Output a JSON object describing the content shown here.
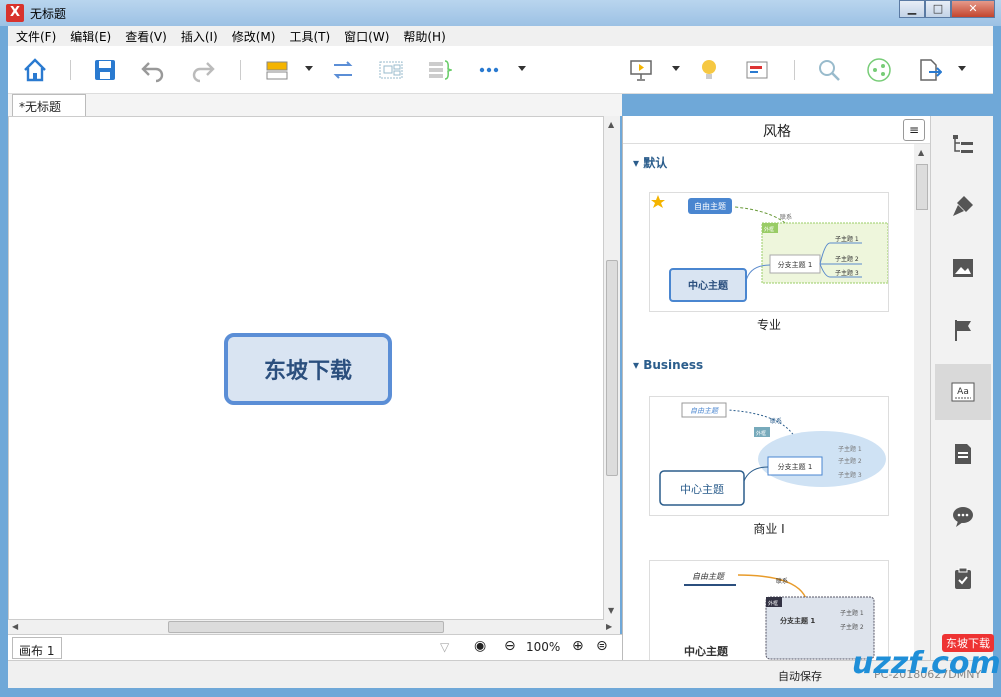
{
  "window": {
    "title": "无标题",
    "app_logo": "X",
    "min": "▁",
    "max": "□",
    "close": "✕"
  },
  "menu": [
    "文件(F)",
    "编辑(E)",
    "查看(V)",
    "插入(I)",
    "修改(M)",
    "工具(T)",
    "窗口(W)",
    "帮助(H)"
  ],
  "toolbar_icons": [
    "home-icon",
    "save-icon",
    "undo-icon",
    "redo-icon",
    "topic-icon",
    "relationship-icon",
    "boundary-icon",
    "summary-icon",
    "more-icon",
    "presentation-icon",
    "idea-icon",
    "gantt-icon",
    "search-icon",
    "share-icon",
    "export-icon"
  ],
  "doc_tab": "*无标题",
  "canvas": {
    "central_topic": "东坡下载"
  },
  "status": {
    "sheet_tab": "画布 1",
    "zoom": "100%",
    "zoom_out": "⊖",
    "zoom_in": "⊕"
  },
  "style_panel": {
    "title": "风格",
    "menu_icon": "≡",
    "sections": [
      {
        "name": "默认",
        "item_label": "专业",
        "thumb": {
          "free": "自由主题",
          "rel": "联系",
          "tag": "外框",
          "branch": "分支主题 1",
          "subs": [
            "子主题 1",
            "子主题 2",
            "子主题 3"
          ],
          "central": "中心主题"
        }
      },
      {
        "name": "Business",
        "item_label": "商业 I",
        "thumb": {
          "free": "自由主题",
          "rel": "联系",
          "tag": "外框",
          "branch": "分支主题 1",
          "subs": [
            "子主题 1",
            "子主题 2",
            "子主题 3"
          ],
          "central": "中心主题"
        }
      },
      {
        "name": "",
        "item_label": "",
        "thumb": {
          "free": "自由主题",
          "rel": "联系",
          "tag": "外框",
          "branch": "分支主题 1",
          "subs": [
            "子主题 1",
            "子主题 2"
          ],
          "central": "中心主题"
        }
      }
    ]
  },
  "sidebar_icons": [
    "outline-icon",
    "format-brush-icon",
    "image-icon",
    "marker-flag-icon",
    "style-icon",
    "notes-icon",
    "comment-icon",
    "task-icon"
  ],
  "sidebar_style_label": "Aa",
  "bottom": {
    "autosave": "自动保存",
    "pc": "PC-20180627DMNY"
  },
  "watermark": {
    "text": "uzzf.com",
    "badge": "东坡下载"
  },
  "colors": {
    "accent": "#5b8ed6",
    "central_fill": "#d9e4f2",
    "section": "#2b5d8c"
  }
}
